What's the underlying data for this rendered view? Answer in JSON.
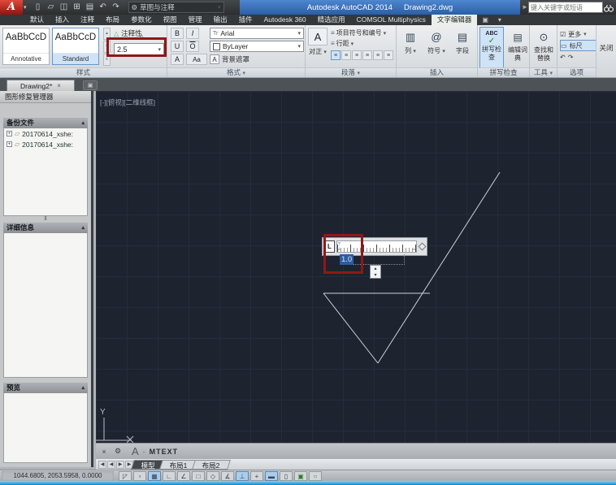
{
  "titlebar": {
    "logo": "A",
    "workspace": "草图与注释",
    "app_title": "Autodesk AutoCAD 2014",
    "doc_title": "Drawing2.dwg",
    "search_placeholder": "键入关键字或短语",
    "qat": [
      {
        "name": "new",
        "glyph": "▯"
      },
      {
        "name": "open",
        "glyph": "▱"
      },
      {
        "name": "save",
        "glyph": "◫"
      },
      {
        "name": "save-as",
        "glyph": "⊞"
      },
      {
        "name": "plot",
        "glyph": "▤"
      },
      {
        "name": "undo",
        "glyph": "↶"
      },
      {
        "name": "redo",
        "glyph": "↷"
      }
    ]
  },
  "icons": {
    "dropdown": "▾",
    "gear": "⚙",
    "arrow_right": "►",
    "ribbon_min": "▣",
    "close_x": "×",
    "wrench": "⚙",
    "expand": "+",
    "folder": "▱",
    "collapse": "▴",
    "splitter": "⇕",
    "check": "✓",
    "checkbox": "☑",
    "ruler": "▭",
    "undo": "↶",
    "redo": "↷",
    "at": "@",
    "columns": "▥",
    "field": "▤",
    "book": "▤",
    "find": "⊙",
    "tr": "Tr",
    "abc": "ABC",
    "lines": "≡",
    "tri": "△",
    "spin_up": "▴",
    "spin_down": "▾",
    "nav_first": "|◀",
    "nav_prev": "◀",
    "nav_next": "▶",
    "nav_last": "▶|"
  },
  "ribbon": {
    "tabs": [
      {
        "label": "默认"
      },
      {
        "label": "插入"
      },
      {
        "label": "注释"
      },
      {
        "label": "布局"
      },
      {
        "label": "参数化"
      },
      {
        "label": "视图"
      },
      {
        "label": "管理"
      },
      {
        "label": "输出"
      },
      {
        "label": "插件"
      },
      {
        "label": "Autodesk 360"
      },
      {
        "label": "精选应用"
      },
      {
        "label": "COMSOL Multiphysics"
      },
      {
        "label": "文字编辑器",
        "active": true
      }
    ],
    "style": {
      "cards": [
        {
          "preview": "AaBbCcD",
          "name": "Annotative",
          "selected": false
        },
        {
          "preview": "AaBbCcD",
          "name": "Standard",
          "selected": true
        }
      ],
      "annotative_label": "注释性",
      "text_height": "2.5",
      "panel_label": "样式"
    },
    "format": {
      "bold": "B",
      "italic": "I",
      "underline": "U",
      "overline": "O",
      "oblique": "A",
      "case": "Aa",
      "font": "Arial",
      "color": "ByLayer",
      "mask": "背景遮罩",
      "panel_label": "格式"
    },
    "paragraph": {
      "justify": "对正",
      "justify_glyph": "A",
      "bullets": "项目符号和编号",
      "line_spacing": "行距",
      "align_buttons": [
        {
          "name": "align-left",
          "pressed": true
        },
        {
          "name": "align-center",
          "pressed": false
        },
        {
          "name": "align-right",
          "pressed": false
        },
        {
          "name": "justify-both",
          "pressed": false
        },
        {
          "name": "distribute",
          "pressed": false
        },
        {
          "name": "paragraph-default",
          "pressed": false
        }
      ],
      "panel_label": "段落"
    },
    "insert": {
      "columns": "列",
      "symbol": "符号",
      "field": "字段",
      "panel_label": "插入"
    },
    "spell": {
      "check": "拼写检查",
      "dict": "编辑词典",
      "panel_label": "拼写检查"
    },
    "tools": {
      "find": "查找和替换",
      "panel_label": "工具"
    },
    "options": {
      "more": "更多",
      "ruler": "标尺",
      "panel_label": "选项"
    },
    "close": {
      "label": "关闭"
    }
  },
  "file_tabs": {
    "tabs": [
      {
        "label": "Drawing2*",
        "modified": true
      }
    ]
  },
  "palette": {
    "title": "图形修复管理器",
    "backup_header": "备份文件",
    "files": [
      {
        "label": "20170614_xshe:"
      },
      {
        "label": "20170614_xshe:"
      }
    ],
    "details_header": "详细信息",
    "preview_header": "预览"
  },
  "canvas": {
    "viewport_label": "[-][俯视][二维线框]",
    "ucs_y": "Y",
    "ucs_x": "X",
    "mtext": {
      "tab_style": "L",
      "value": "1.0"
    }
  },
  "command_line": {
    "prompt": "A",
    "command": "MTEXT"
  },
  "layout_tabs": [
    {
      "label": "模型",
      "active": true
    },
    {
      "label": "布局1",
      "active": false
    },
    {
      "label": "布局2",
      "active": false
    }
  ],
  "statusbar": {
    "coordinates": "1044.6805, 2053.5958, 0.0000",
    "toggles": [
      {
        "name": "infer-constraints",
        "glyph": "◸",
        "pressed": false
      },
      {
        "name": "snap-mode",
        "glyph": "▫",
        "pressed": false
      },
      {
        "name": "grid-display",
        "glyph": "▦",
        "pressed": true
      },
      {
        "name": "ortho-mode",
        "glyph": "∟",
        "pressed": false
      },
      {
        "name": "polar-tracking",
        "glyph": "∠",
        "pressed": false
      },
      {
        "name": "object-snap",
        "glyph": "□",
        "pressed": false
      },
      {
        "name": "3d-object-snap",
        "glyph": "◇",
        "pressed": false
      },
      {
        "name": "object-snap-tracking",
        "glyph": "∡",
        "pressed": false
      },
      {
        "name": "dynamic-ucs",
        "glyph": "⊥",
        "pressed": true
      },
      {
        "name": "dynamic-input",
        "glyph": "+",
        "pressed": false
      },
      {
        "name": "lineweight",
        "glyph": "▬",
        "pressed": true
      },
      {
        "name": "transparency",
        "glyph": "▯",
        "pressed": false
      },
      {
        "name": "quick-properties",
        "glyph": "▣",
        "pressed": false
      },
      {
        "name": "selection-cycling",
        "glyph": "○",
        "pressed": false
      }
    ]
  },
  "colors": {
    "title_accent": "#3b78c4",
    "annotation_red": "#8f1818",
    "canvas_bg": "#1e2330",
    "ribbon_highlight": "#cfe3f7",
    "contextual_tab": "#e9f0e9",
    "taskbar_blue": "#2aa3dc"
  }
}
